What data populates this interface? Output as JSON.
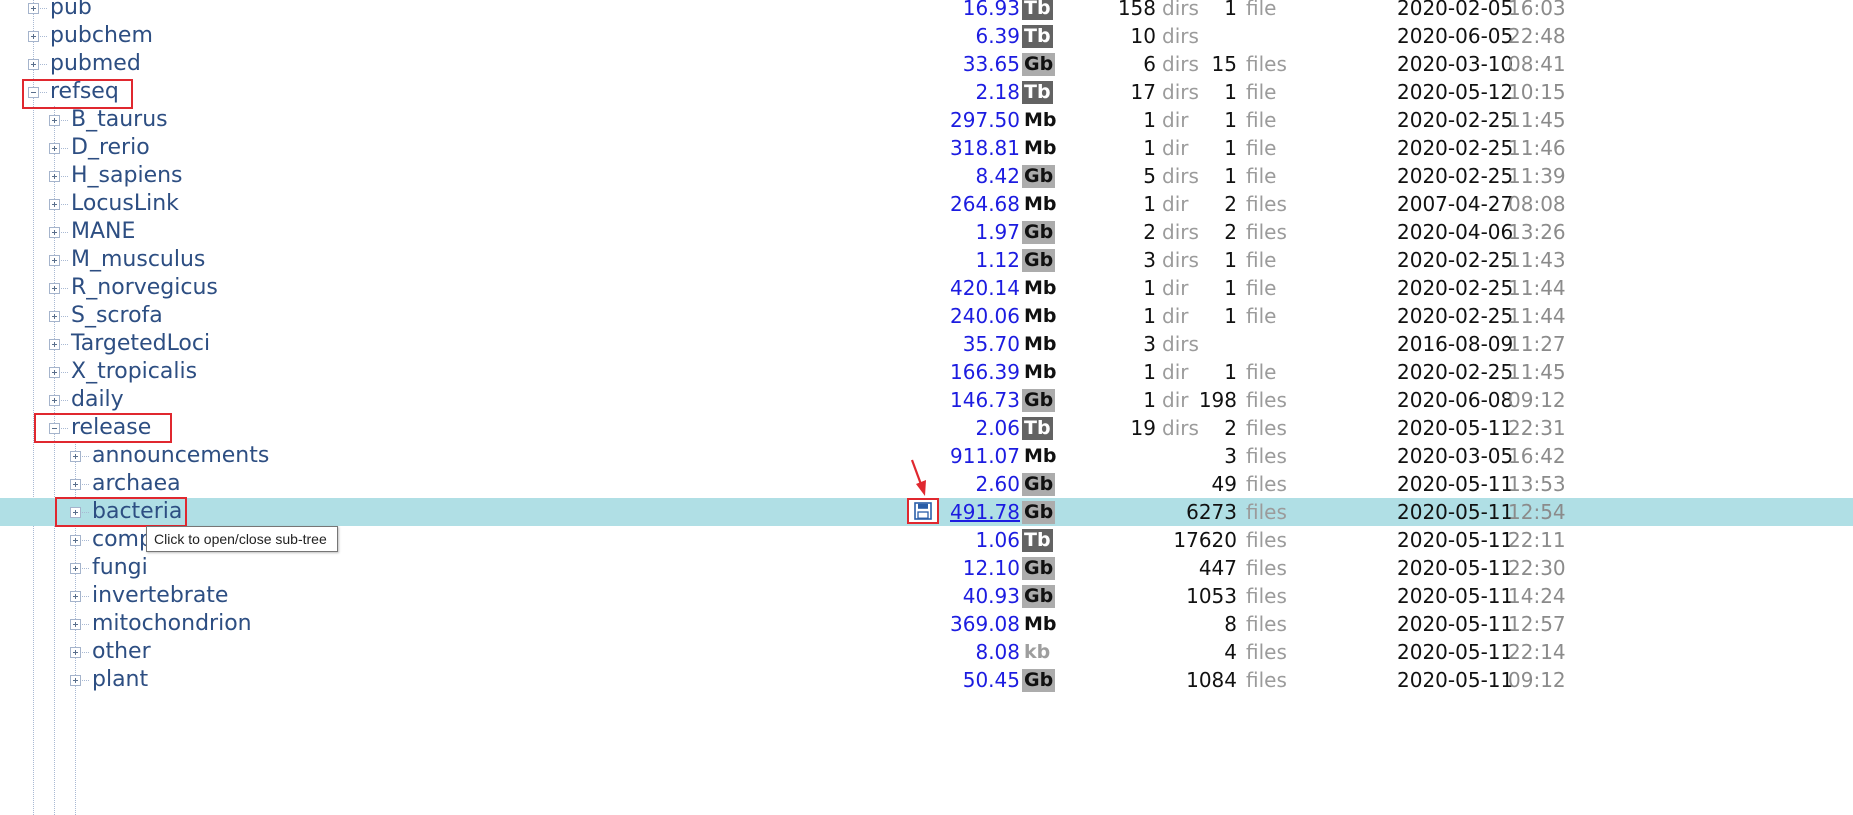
{
  "tooltip": "Click to open/close sub-tree",
  "colors": {
    "highlight": "#b0dfe5",
    "annotation": "#e0282f",
    "size_link": "#1c1ce0",
    "name": "#2d4e82"
  },
  "icons": {
    "save": "save-icon",
    "expand": "plus-box-icon",
    "collapse": "minus-box-icon",
    "arrow": "red-arrow"
  },
  "rows": [
    {
      "name": "pub",
      "level": 0,
      "state": "collapsed",
      "size": "16.93",
      "unit": "Tb",
      "dirs": "158",
      "dirs_label": "dirs",
      "files": "1",
      "files_label": "file",
      "date": "2020-02-05",
      "time": "16:03"
    },
    {
      "name": "pubchem",
      "level": 0,
      "state": "collapsed",
      "size": "6.39",
      "unit": "Tb",
      "dirs": "10",
      "dirs_label": "dirs",
      "files": "",
      "files_label": "",
      "date": "2020-06-05",
      "time": "22:48"
    },
    {
      "name": "pubmed",
      "level": 0,
      "state": "collapsed",
      "size": "33.65",
      "unit": "Gb",
      "dirs": "6",
      "dirs_label": "dirs",
      "files": "15",
      "files_label": "files",
      "date": "2020-03-10",
      "time": "08:41"
    },
    {
      "name": "refseq",
      "level": 0,
      "state": "expanded",
      "size": "2.18",
      "unit": "Tb",
      "dirs": "17",
      "dirs_label": "dirs",
      "files": "1",
      "files_label": "file",
      "date": "2020-05-12",
      "time": "10:15"
    },
    {
      "name": "B_taurus",
      "level": 1,
      "state": "collapsed",
      "size": "297.50",
      "unit": "Mb",
      "dirs": "1",
      "dirs_label": "dir",
      "files": "1",
      "files_label": "file",
      "date": "2020-02-25",
      "time": "11:45"
    },
    {
      "name": "D_rerio",
      "level": 1,
      "state": "collapsed",
      "size": "318.81",
      "unit": "Mb",
      "dirs": "1",
      "dirs_label": "dir",
      "files": "1",
      "files_label": "file",
      "date": "2020-02-25",
      "time": "11:46"
    },
    {
      "name": "H_sapiens",
      "level": 1,
      "state": "collapsed",
      "size": "8.42",
      "unit": "Gb",
      "dirs": "5",
      "dirs_label": "dirs",
      "files": "1",
      "files_label": "file",
      "date": "2020-02-25",
      "time": "11:39"
    },
    {
      "name": "LocusLink",
      "level": 1,
      "state": "collapsed",
      "size": "264.68",
      "unit": "Mb",
      "dirs": "1",
      "dirs_label": "dir",
      "files": "2",
      "files_label": "files",
      "date": "2007-04-27",
      "time": "08:08"
    },
    {
      "name": "MANE",
      "level": 1,
      "state": "collapsed",
      "size": "1.97",
      "unit": "Gb",
      "dirs": "2",
      "dirs_label": "dirs",
      "files": "2",
      "files_label": "files",
      "date": "2020-04-06",
      "time": "13:26"
    },
    {
      "name": "M_musculus",
      "level": 1,
      "state": "collapsed",
      "size": "1.12",
      "unit": "Gb",
      "dirs": "3",
      "dirs_label": "dirs",
      "files": "1",
      "files_label": "file",
      "date": "2020-02-25",
      "time": "11:43"
    },
    {
      "name": "R_norvegicus",
      "level": 1,
      "state": "collapsed",
      "size": "420.14",
      "unit": "Mb",
      "dirs": "1",
      "dirs_label": "dir",
      "files": "1",
      "files_label": "file",
      "date": "2020-02-25",
      "time": "11:44"
    },
    {
      "name": "S_scrofa",
      "level": 1,
      "state": "collapsed",
      "size": "240.06",
      "unit": "Mb",
      "dirs": "1",
      "dirs_label": "dir",
      "files": "1",
      "files_label": "file",
      "date": "2020-02-25",
      "time": "11:44"
    },
    {
      "name": "TargetedLoci",
      "level": 1,
      "state": "collapsed",
      "size": "35.70",
      "unit": "Mb",
      "dirs": "3",
      "dirs_label": "dirs",
      "files": "",
      "files_label": "",
      "date": "2016-08-09",
      "time": "11:27"
    },
    {
      "name": "X_tropicalis",
      "level": 1,
      "state": "collapsed",
      "size": "166.39",
      "unit": "Mb",
      "dirs": "1",
      "dirs_label": "dir",
      "files": "1",
      "files_label": "file",
      "date": "2020-02-25",
      "time": "11:45"
    },
    {
      "name": "daily",
      "level": 1,
      "state": "collapsed",
      "size": "146.73",
      "unit": "Gb",
      "dirs": "1",
      "dirs_label": "dir",
      "files": "198",
      "files_label": "files",
      "date": "2020-06-08",
      "time": "09:12"
    },
    {
      "name": "release",
      "level": 1,
      "state": "expanded",
      "size": "2.06",
      "unit": "Tb",
      "dirs": "19",
      "dirs_label": "dirs",
      "files": "2",
      "files_label": "files",
      "date": "2020-05-11",
      "time": "22:31"
    },
    {
      "name": "announcements",
      "level": 2,
      "state": "collapsed",
      "size": "911.07",
      "unit": "Mb",
      "dirs": "",
      "dirs_label": "",
      "files": "3",
      "files_label": "files",
      "date": "2020-03-05",
      "time": "16:42"
    },
    {
      "name": "archaea",
      "level": 2,
      "state": "collapsed",
      "size": "2.60",
      "unit": "Gb",
      "dirs": "",
      "dirs_label": "",
      "files": "49",
      "files_label": "files",
      "date": "2020-05-11",
      "time": "13:53"
    },
    {
      "name": "bacteria",
      "level": 2,
      "state": "collapsed",
      "size": "491.78",
      "unit": "Gb",
      "dirs": "",
      "dirs_label": "",
      "files": "6273",
      "files_label": "files",
      "date": "2020-05-11",
      "time": "12:54",
      "selected": true
    },
    {
      "name": "complete",
      "level": 2,
      "state": "collapsed",
      "size": "1.06",
      "unit": "Tb",
      "dirs": "",
      "dirs_label": "",
      "files": "17620",
      "files_label": "files",
      "date": "2020-05-11",
      "time": "22:11"
    },
    {
      "name": "fungi",
      "level": 2,
      "state": "collapsed",
      "size": "12.10",
      "unit": "Gb",
      "dirs": "",
      "dirs_label": "",
      "files": "447",
      "files_label": "files",
      "date": "2020-05-11",
      "time": "22:30"
    },
    {
      "name": "invertebrate",
      "level": 2,
      "state": "collapsed",
      "size": "40.93",
      "unit": "Gb",
      "dirs": "",
      "dirs_label": "",
      "files": "1053",
      "files_label": "files",
      "date": "2020-05-11",
      "time": "14:24"
    },
    {
      "name": "mitochondrion",
      "level": 2,
      "state": "collapsed",
      "size": "369.08",
      "unit": "Mb",
      "dirs": "",
      "dirs_label": "",
      "files": "8",
      "files_label": "files",
      "date": "2020-05-11",
      "time": "12:57"
    },
    {
      "name": "other",
      "level": 2,
      "state": "collapsed",
      "size": "8.08",
      "unit": "kb",
      "dirs": "",
      "dirs_label": "",
      "files": "4",
      "files_label": "files",
      "date": "2020-05-11",
      "time": "22:14"
    },
    {
      "name": "plant",
      "level": 2,
      "state": "collapsed",
      "size": "50.45",
      "unit": "Gb",
      "dirs": "",
      "dirs_label": "",
      "files": "1084",
      "files_label": "files",
      "date": "2020-05-11",
      "time": "09:12"
    }
  ]
}
